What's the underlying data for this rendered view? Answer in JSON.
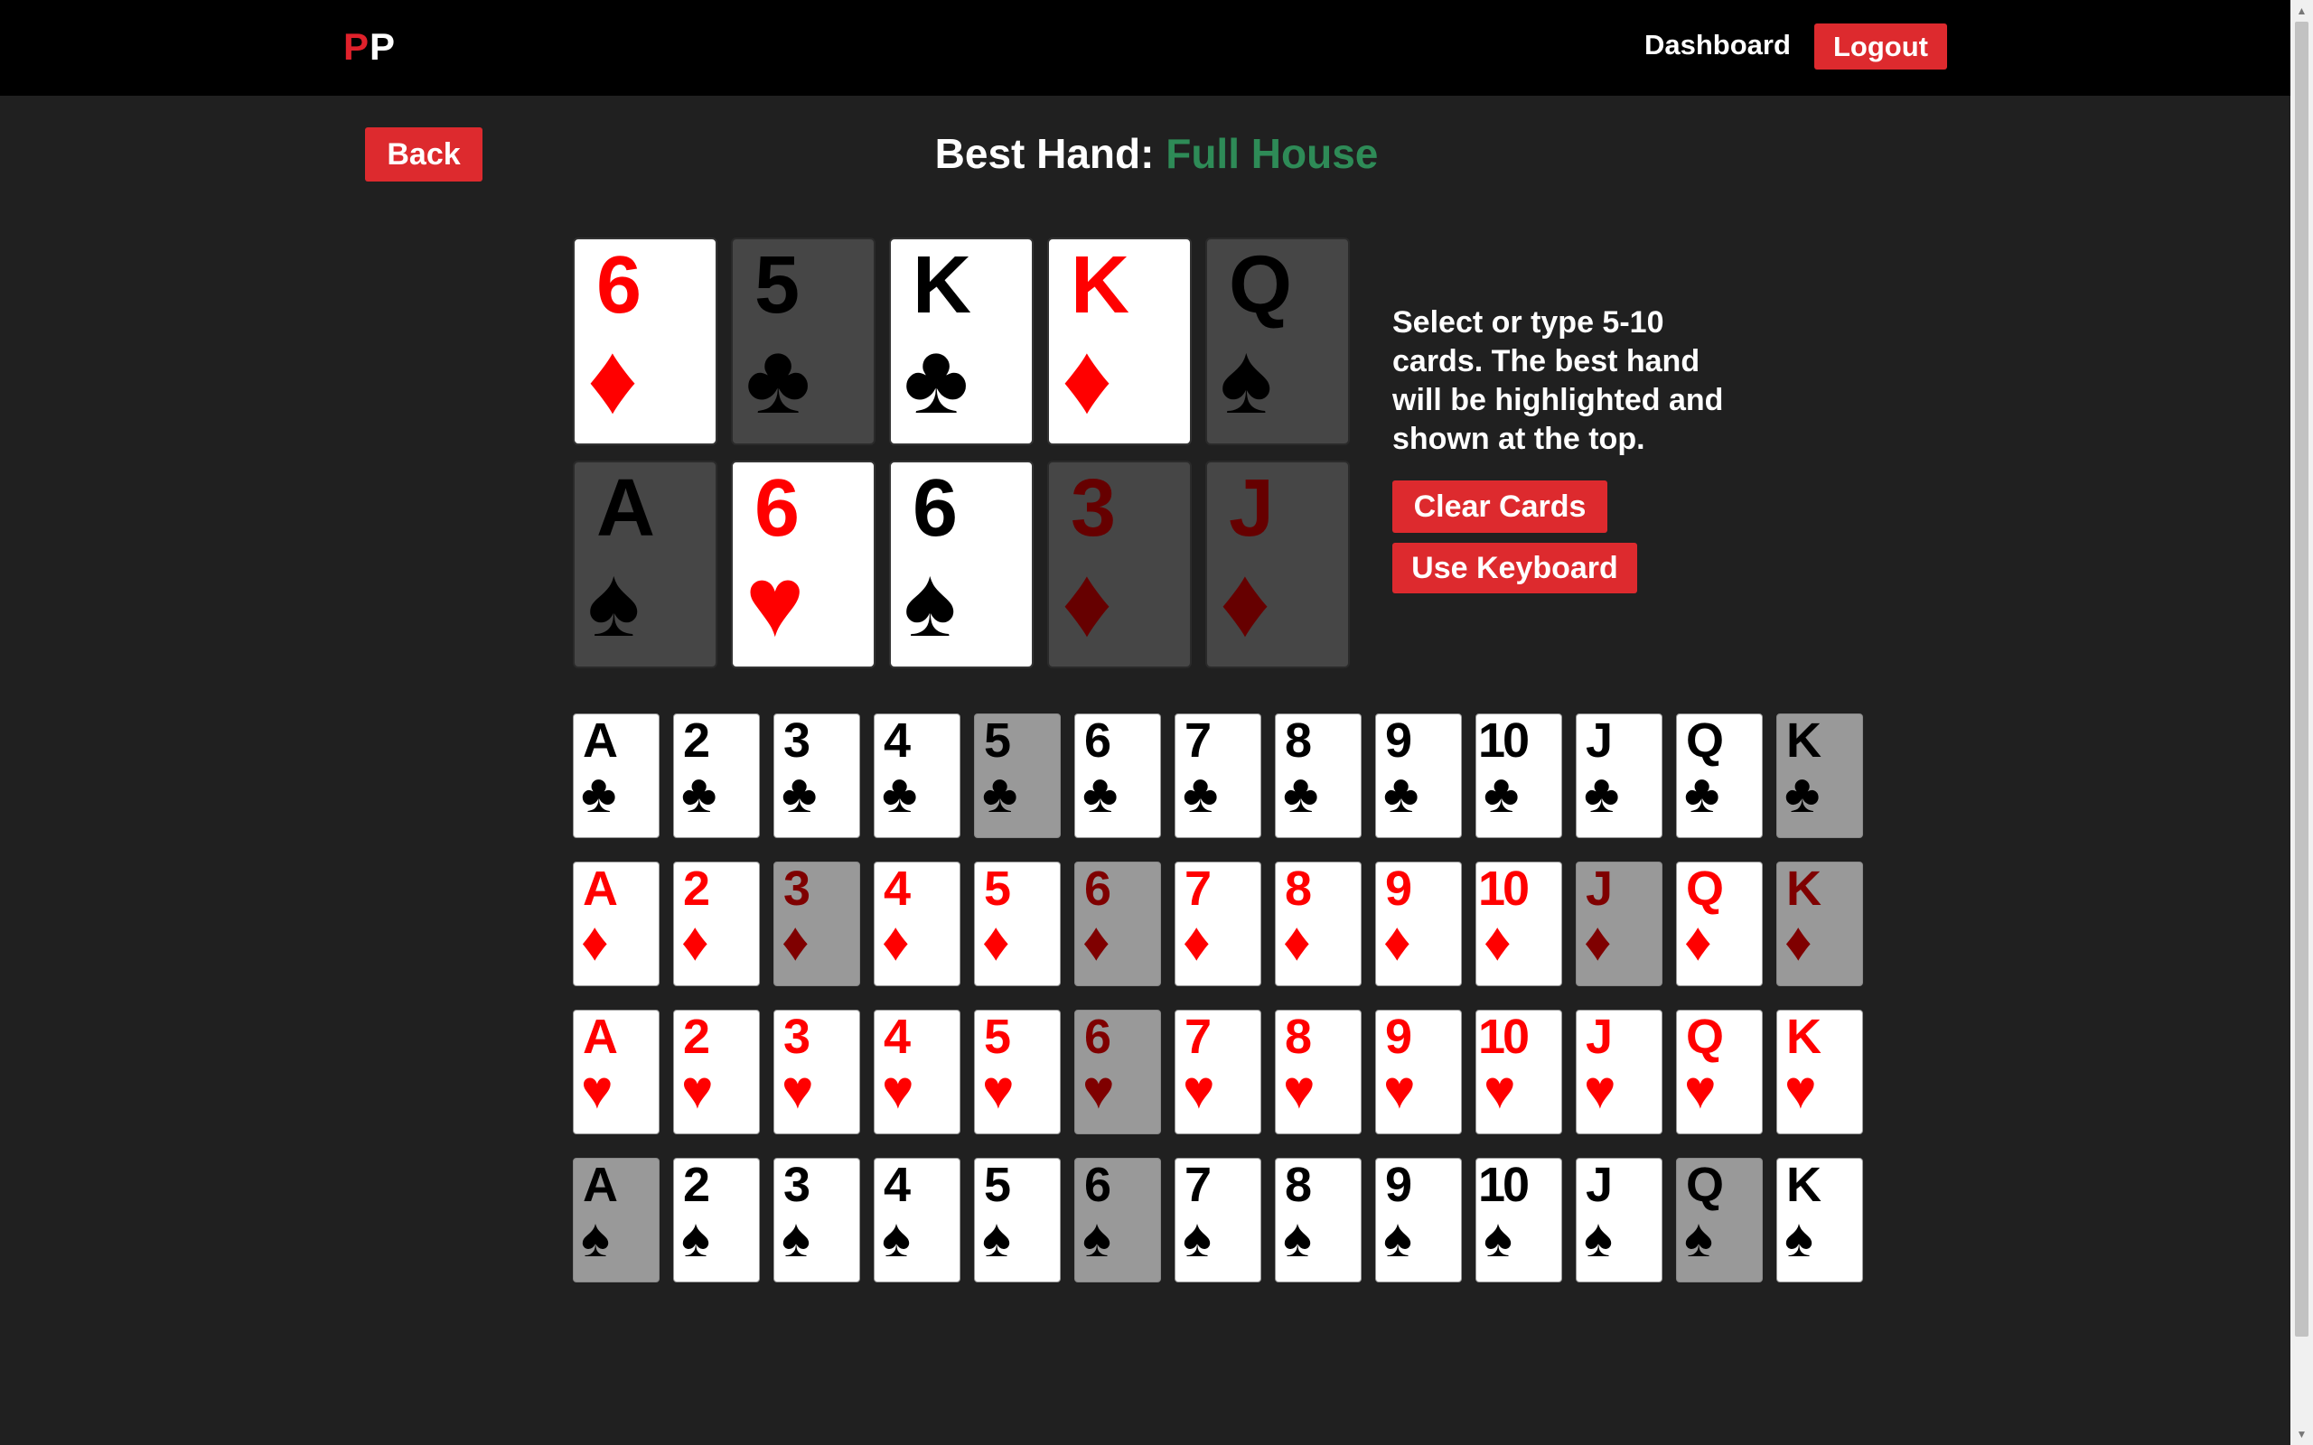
{
  "nav": {
    "logo_first": "P",
    "logo_second": "P",
    "dashboard_label": "Dashboard",
    "logout_label": "Logout"
  },
  "page": {
    "back_label": "Back",
    "best_hand_label": "Best Hand:",
    "best_hand_value": "Full House",
    "instructions": "Select or type 5-10 cards. The best hand will be highlighted and shown at the top.",
    "clear_label": "Clear Cards",
    "keyboard_label": "Use Keyboard"
  },
  "colors": {
    "accent_red": "#dd2a2e",
    "best_hand_green": "#2e8b57",
    "background": "#202020"
  },
  "selected_cards": [
    {
      "rank": "6",
      "suit": "♦",
      "color": "red",
      "highlighted": true
    },
    {
      "rank": "5",
      "suit": "♣",
      "color": "black",
      "highlighted": false
    },
    {
      "rank": "K",
      "suit": "♣",
      "color": "black",
      "highlighted": true
    },
    {
      "rank": "K",
      "suit": "♦",
      "color": "red",
      "highlighted": true
    },
    {
      "rank": "Q",
      "suit": "♠",
      "color": "black",
      "highlighted": false
    },
    {
      "rank": "A",
      "suit": "♠",
      "color": "black",
      "highlighted": false
    },
    {
      "rank": "6",
      "suit": "♥",
      "color": "red",
      "highlighted": true
    },
    {
      "rank": "6",
      "suit": "♠",
      "color": "black",
      "highlighted": true
    },
    {
      "rank": "3",
      "suit": "♦",
      "color": "red",
      "highlighted": false
    },
    {
      "rank": "J",
      "suit": "♦",
      "color": "red",
      "highlighted": false
    }
  ],
  "picker": {
    "ranks": [
      "A",
      "2",
      "3",
      "4",
      "5",
      "6",
      "7",
      "8",
      "9",
      "10",
      "J",
      "Q",
      "K"
    ],
    "rows": [
      {
        "suit": "♣",
        "suit_name": "clubs",
        "color": "black",
        "selected": [
          "5",
          "K"
        ]
      },
      {
        "suit": "♦",
        "suit_name": "diamonds",
        "color": "red",
        "selected": [
          "3",
          "6",
          "J",
          "K"
        ]
      },
      {
        "suit": "♥",
        "suit_name": "hearts",
        "color": "red",
        "selected": [
          "6"
        ]
      },
      {
        "suit": "♠",
        "suit_name": "spades",
        "color": "black",
        "selected": [
          "A",
          "6",
          "Q"
        ]
      }
    ]
  }
}
